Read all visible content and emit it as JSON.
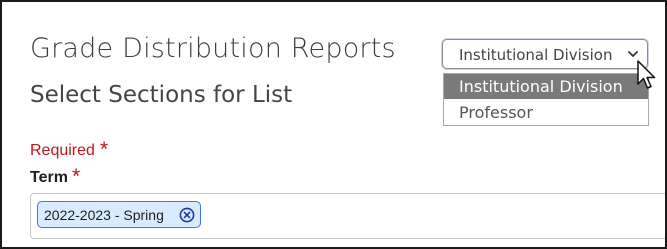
{
  "header": {
    "title": "Grade Distribution Reports",
    "subtitle": "Select Sections for List"
  },
  "report_type_select": {
    "value": "Institutional Division",
    "options": [
      "Institutional Division",
      "Professor"
    ],
    "selected_index": 0
  },
  "form": {
    "required_label": "Required",
    "required_marker": "*",
    "term_label": "Term",
    "term_marker": "*",
    "term_chips": [
      {
        "label": "2022-2023 - Spring"
      }
    ]
  },
  "colors": {
    "required": "#c0141a",
    "chip_bg": "#d9ecff",
    "chip_border": "#3d7cc8",
    "option_selected_bg": "#7a7a7a"
  },
  "icons": {
    "select": "chevron-down-icon",
    "chip_remove": "circle-x-icon",
    "pointer": "cursor-arrow-icon"
  }
}
